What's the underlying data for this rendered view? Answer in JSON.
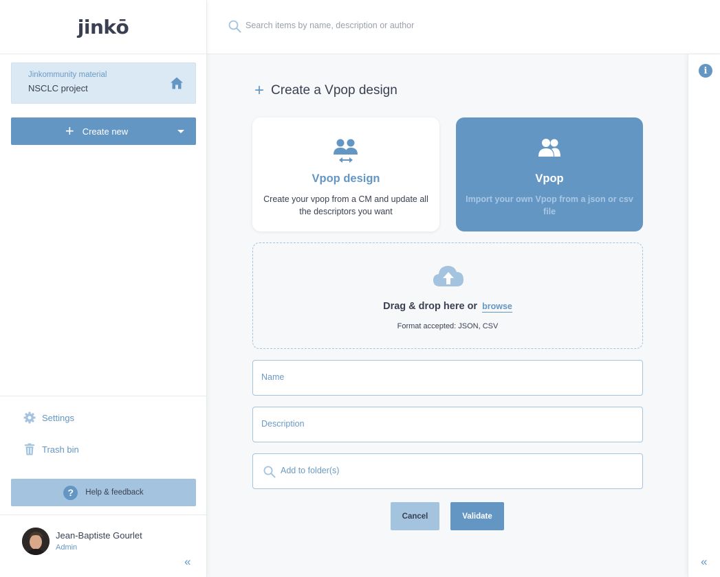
{
  "sidebar": {
    "logo": "jinkō",
    "project": {
      "label": "Jinkommunity material",
      "name": "NSCLC project"
    },
    "create_button": "Create new",
    "settings": "Settings",
    "trash": "Trash bin",
    "help": "Help & feedback",
    "user": {
      "name": "Jean-Baptiste Gourlet",
      "role": "Admin"
    },
    "collapse": "«"
  },
  "topbar": {
    "search_placeholder": "Search items by name, description or author"
  },
  "right_rail": {
    "info": "i",
    "collapse": "«"
  },
  "main": {
    "title": "Create a Vpop design",
    "options": [
      {
        "title": "Vpop design",
        "description": "Create your vpop from a CM and update all the descriptors you want",
        "selected": true
      },
      {
        "title": "Vpop",
        "description": "Import your own Vpop from a json or csv file",
        "selected": false
      }
    ],
    "dropzone": {
      "text": "Drag & drop here or",
      "browse": "browse",
      "formats": "Format accepted: JSON, CSV"
    },
    "name_placeholder": "Name",
    "description_placeholder": "Description",
    "folder_placeholder": "Add to folder(s)",
    "cancel": "Cancel",
    "validate": "Validate"
  },
  "colors": {
    "accent": "#6496c4",
    "accent_light": "#a3c3df",
    "project_bg": "#dbe9f4",
    "text": "#3a3f52"
  }
}
